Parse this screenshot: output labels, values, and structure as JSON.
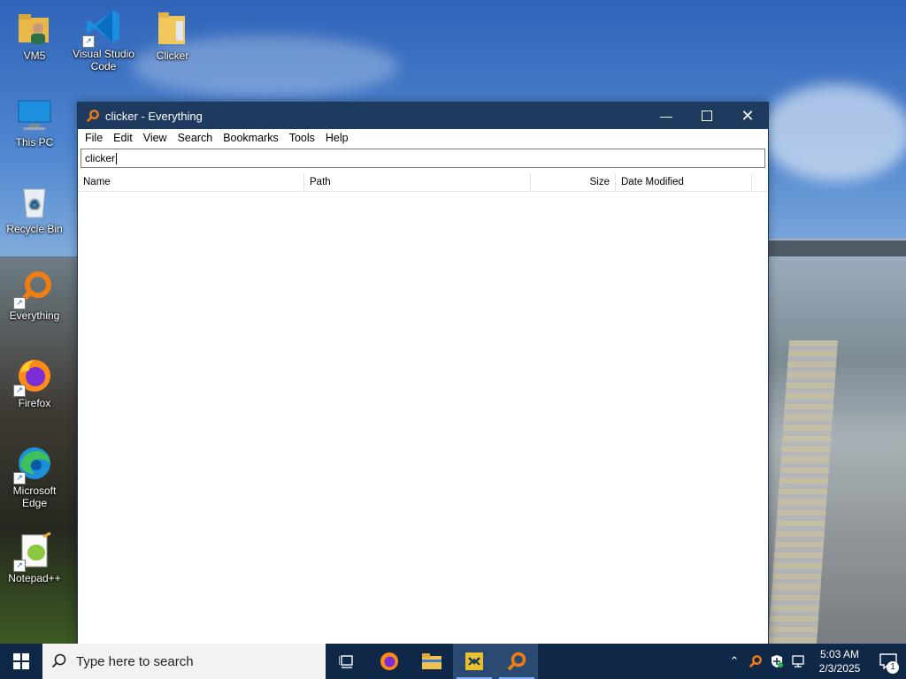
{
  "desktop": {
    "icons": [
      {
        "label": "VM5"
      },
      {
        "label": "Visual Studio Code"
      },
      {
        "label": "Clicker"
      },
      {
        "label": "This PC"
      },
      {
        "label": "Recycle Bin"
      },
      {
        "label": "Everything"
      },
      {
        "label": "Firefox"
      },
      {
        "label": "Microsoft Edge"
      },
      {
        "label": "Notepad++"
      }
    ]
  },
  "window": {
    "title": "clicker - Everything",
    "menu": [
      "File",
      "Edit",
      "View",
      "Search",
      "Bookmarks",
      "Tools",
      "Help"
    ],
    "search_value": "clicker",
    "columns": {
      "name": "Name",
      "path": "Path",
      "size": "Size",
      "date": "Date Modified"
    }
  },
  "taskbar": {
    "search_placeholder": "Type here to search",
    "time": "5:03 AM",
    "date": "2/3/2025",
    "notification_count": "1"
  },
  "colors": {
    "titlebar": "#1f3a5f",
    "taskbar": "#0f2847",
    "everything_orange": "#f07d12"
  }
}
